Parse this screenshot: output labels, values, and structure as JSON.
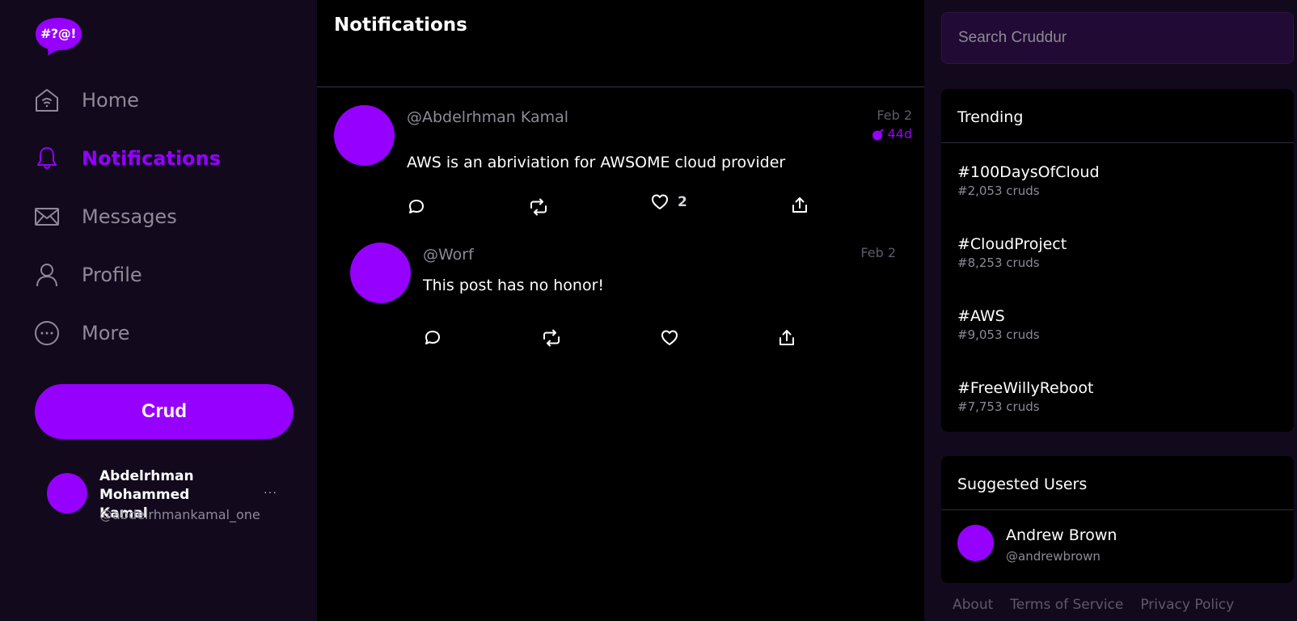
{
  "app": {
    "logo_text": "#?@!"
  },
  "nav": {
    "items": [
      {
        "label": "Home",
        "icon": "home-icon",
        "active": false
      },
      {
        "label": "Notifications",
        "icon": "bell-icon",
        "active": true
      },
      {
        "label": "Messages",
        "icon": "envelope-icon",
        "active": false
      },
      {
        "label": "Profile",
        "icon": "user-icon",
        "active": false
      },
      {
        "label": "More",
        "icon": "more-circle-icon",
        "active": false
      }
    ],
    "crud_button": "Crud"
  },
  "current_user": {
    "display_name": "Abdelrhman Mohammed Kamal",
    "handle": "@abdelrhmankamal_one",
    "menu_label": "···"
  },
  "main": {
    "title": "Notifications",
    "posts": [
      {
        "handle": "@Abdelrhman Kamal",
        "date": "Feb 2",
        "expires": "44d",
        "text": "AWS is an abriviation for AWSOME cloud provider",
        "likes": "2"
      },
      {
        "handle": "@Worf",
        "date": "Feb 2",
        "text": "This post has no honor!"
      }
    ]
  },
  "search": {
    "placeholder": "Search Cruddur"
  },
  "trending": {
    "title": "Trending",
    "items": [
      {
        "tag": "#100DaysOfCloud",
        "count": "#2,053 cruds"
      },
      {
        "tag": "#CloudProject",
        "count": "#8,253 cruds"
      },
      {
        "tag": "#AWS",
        "count": "#9,053 cruds"
      },
      {
        "tag": "#FreeWillyReboot",
        "count": "#7,753 cruds"
      }
    ]
  },
  "suggested": {
    "title": "Suggested Users",
    "users": [
      {
        "name": "Andrew Brown",
        "handle": "@andrewbrown"
      }
    ]
  },
  "footer": {
    "links": [
      "About",
      "Terms of Service",
      "Privacy Policy"
    ]
  },
  "colors": {
    "accent": "#9500ff",
    "sidebar_bg": "#12091d",
    "feed_bg": "#000000",
    "muted_text": "#8e8a96"
  }
}
